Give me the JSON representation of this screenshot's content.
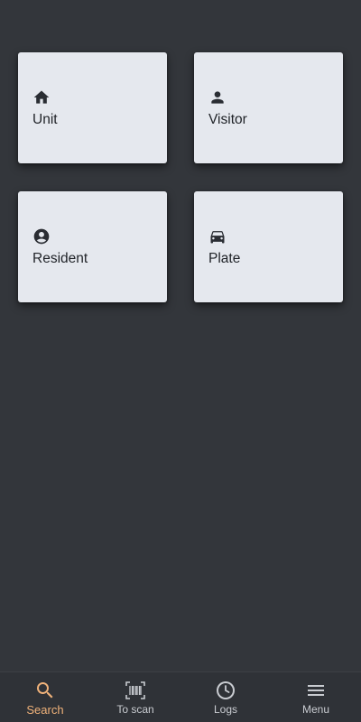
{
  "colors": {
    "background": "#33363b",
    "card": "#e5e8ee",
    "card_text": "#1f2227",
    "nav_background": "#2f3237",
    "nav_active": "#f0b27a",
    "nav_inactive": "#c9ccd1"
  },
  "cards": [
    {
      "label": "Unit",
      "icon": "home-icon"
    },
    {
      "label": "Visitor",
      "icon": "person-icon"
    },
    {
      "label": "Resident",
      "icon": "account-circle-icon"
    },
    {
      "label": "Plate",
      "icon": "car-icon"
    }
  ],
  "bottom_nav": {
    "active": "Search",
    "items": [
      {
        "label": "Search",
        "icon": "search-icon"
      },
      {
        "label": "To scan",
        "icon": "barcode-icon"
      },
      {
        "label": "Logs",
        "icon": "clock-icon"
      },
      {
        "label": "Menu",
        "icon": "menu-icon"
      }
    ]
  }
}
